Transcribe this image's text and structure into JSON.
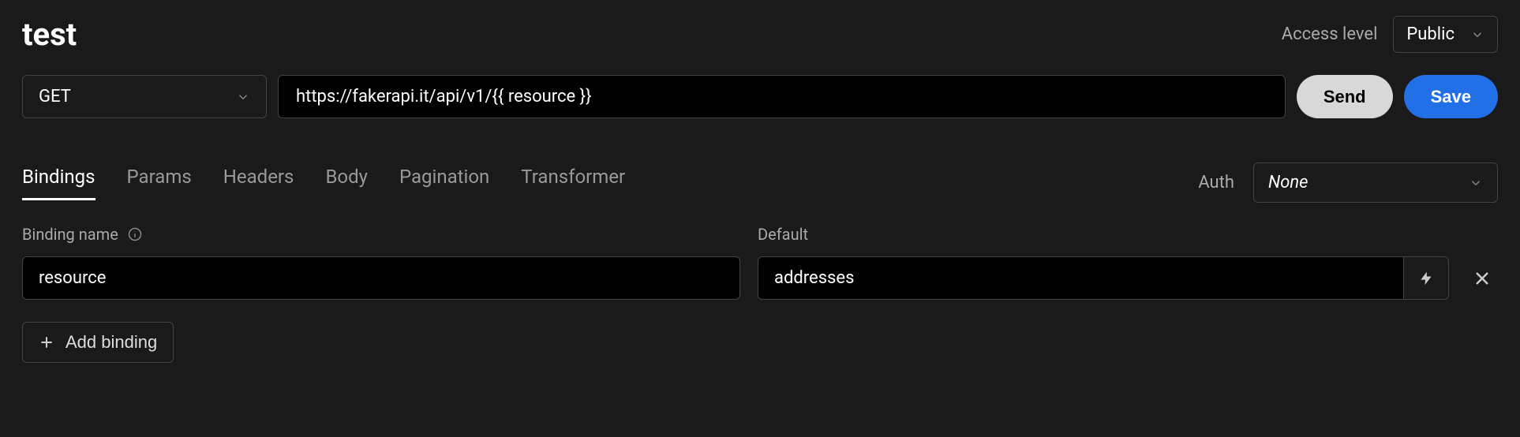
{
  "header": {
    "title": "test",
    "access_level_label": "Access level",
    "access_level_value": "Public"
  },
  "request": {
    "method": "GET",
    "url": "https://fakerapi.it/api/v1/{{ resource }}",
    "send_label": "Send",
    "save_label": "Save"
  },
  "tabs": [
    "Bindings",
    "Params",
    "Headers",
    "Body",
    "Pagination",
    "Transformer"
  ],
  "active_tab_index": 0,
  "auth": {
    "label": "Auth",
    "value": "None"
  },
  "bindings_section": {
    "name_label": "Binding name",
    "default_label": "Default",
    "rows": [
      {
        "name": "resource",
        "default": "addresses"
      }
    ],
    "add_label": "Add binding"
  }
}
